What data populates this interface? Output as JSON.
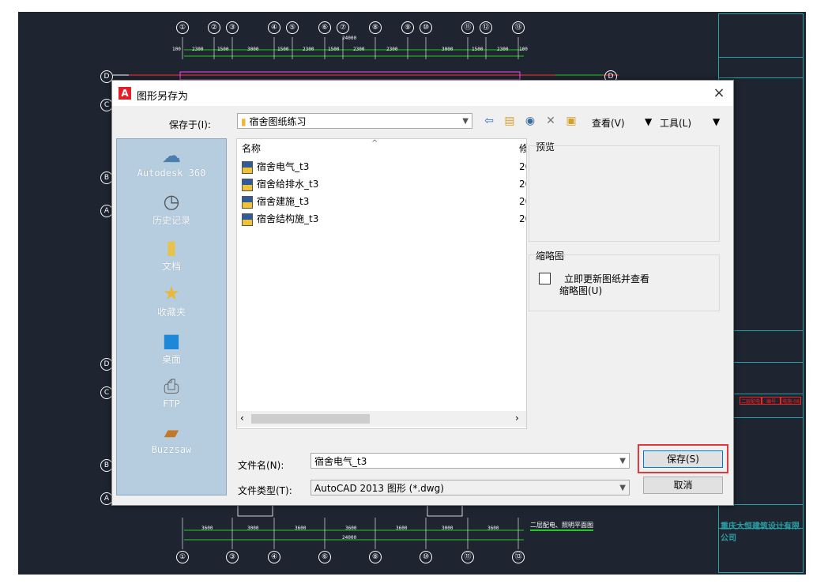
{
  "cad": {
    "top_axes": [
      "①",
      "②",
      "③",
      "④",
      "⑤",
      "⑥",
      "⑦",
      "⑧",
      "⑨",
      "⑩",
      "⑪",
      "⑫",
      "⑬"
    ],
    "bottom_axes": [
      "①",
      "③",
      "④",
      "⑥",
      "⑧",
      "⑩",
      "⑪",
      "⑬"
    ],
    "left_axes": [
      "D",
      "C",
      "B",
      "A",
      "D",
      "C",
      "B",
      "A"
    ],
    "right_axis": "D",
    "top_dims": [
      "100",
      "2300",
      "1500",
      "3000",
      "1500",
      "2300",
      "1500",
      "2300",
      "2300",
      "3000",
      "1500",
      "2300",
      "100"
    ],
    "top_total": "24000",
    "bottom_dims": [
      "3600",
      "3000",
      "3600",
      "3600",
      "3600",
      "3000",
      "3600"
    ],
    "bottom_total": "24000",
    "plan_caption": "二层配电、照明平面图",
    "company_name": "重庆大恒建筑设计有限公司",
    "title_block_marks": [
      "二层配电",
      "编号",
      "电施-08"
    ]
  },
  "dialog": {
    "title": "图形另存为",
    "close_icon": "×",
    "save_in_label": "保存于(I):",
    "save_in_value": "宿舍图纸练习",
    "view_label": "查看(V)",
    "tools_label": "工具(L)",
    "places": [
      {
        "label": "Autodesk 360",
        "icon": "cloud-icon"
      },
      {
        "label": "历史记录",
        "icon": "history-icon"
      },
      {
        "label": "文档",
        "icon": "documents-icon"
      },
      {
        "label": "收藏夹",
        "icon": "favorites-icon"
      },
      {
        "label": "桌面",
        "icon": "desktop-icon"
      },
      {
        "label": "FTP",
        "icon": "ftp-icon"
      },
      {
        "label": "Buzzsaw",
        "icon": "buzzsaw-icon"
      }
    ],
    "list_header_name": "名称",
    "list_header_mod": "修",
    "files": [
      {
        "name": "宿舍电气_t3",
        "date": "20"
      },
      {
        "name": "宿舍给排水_t3",
        "date": "20"
      },
      {
        "name": "宿舍建施_t3",
        "date": "20"
      },
      {
        "name": "宿舍结构施_t3",
        "date": "20"
      }
    ],
    "preview_label": "预览",
    "thumbnail_label": "缩略图",
    "thumbnail_check_line1": "立即更新图纸并查看",
    "thumbnail_check_line2": "缩略图(U)",
    "filename_label": "文件名(N):",
    "filename_value": "宿舍电气_t3",
    "filetype_label": "文件类型(T):",
    "filetype_value": "AutoCAD 2013 图形 (*.dwg)",
    "save_button": "保存(S)",
    "cancel_button": "取消"
  },
  "colors": {
    "highlight": "#e23a3a",
    "cad_background": "#1e2530",
    "cad_teal": "#2aa0a6"
  }
}
